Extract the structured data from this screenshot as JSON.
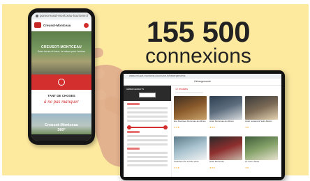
{
  "headline": {
    "number": "155 500",
    "label": "connexions"
  },
  "phone": {
    "url": "ponecreusot-montceau-tourisme.fr",
    "site_title": "Creusot-Montceau",
    "hero_title": "CREUSOT-MONTCEAU",
    "hero_sub": "Entre terres et eaux, la nature pour horizon",
    "things_title": "TANT DE CHOSES",
    "things_accent": "à ne pas manquer",
    "photo_caption_1": "Creusot-Montceau",
    "photo_caption_2": "360°"
  },
  "tablet": {
    "url": "www.creusot-montceau-tourisme.fr/hebergements",
    "page_title": "Hébergements",
    "results_count": "10 résultats",
    "sidebar_title": "HÉBERGEMENTS",
    "cards": [
      {
        "name": "Eco Boutique Montceau-les-Mines",
        "stars": "★★★"
      },
      {
        "name": "Hôtel Montceau-les-Mines",
        "stars": "★★★"
      },
      {
        "name": "Hôtel restaurant Saint-Bérain",
        "stars": "★★"
      },
      {
        "name": "Chambres de la Voie Verte",
        "stars": "★★★"
      },
      {
        "name": "Hôtel Montceau",
        "stars": "★★★"
      },
      {
        "name": "La Vieux Saule",
        "stars": "★★"
      }
    ]
  }
}
